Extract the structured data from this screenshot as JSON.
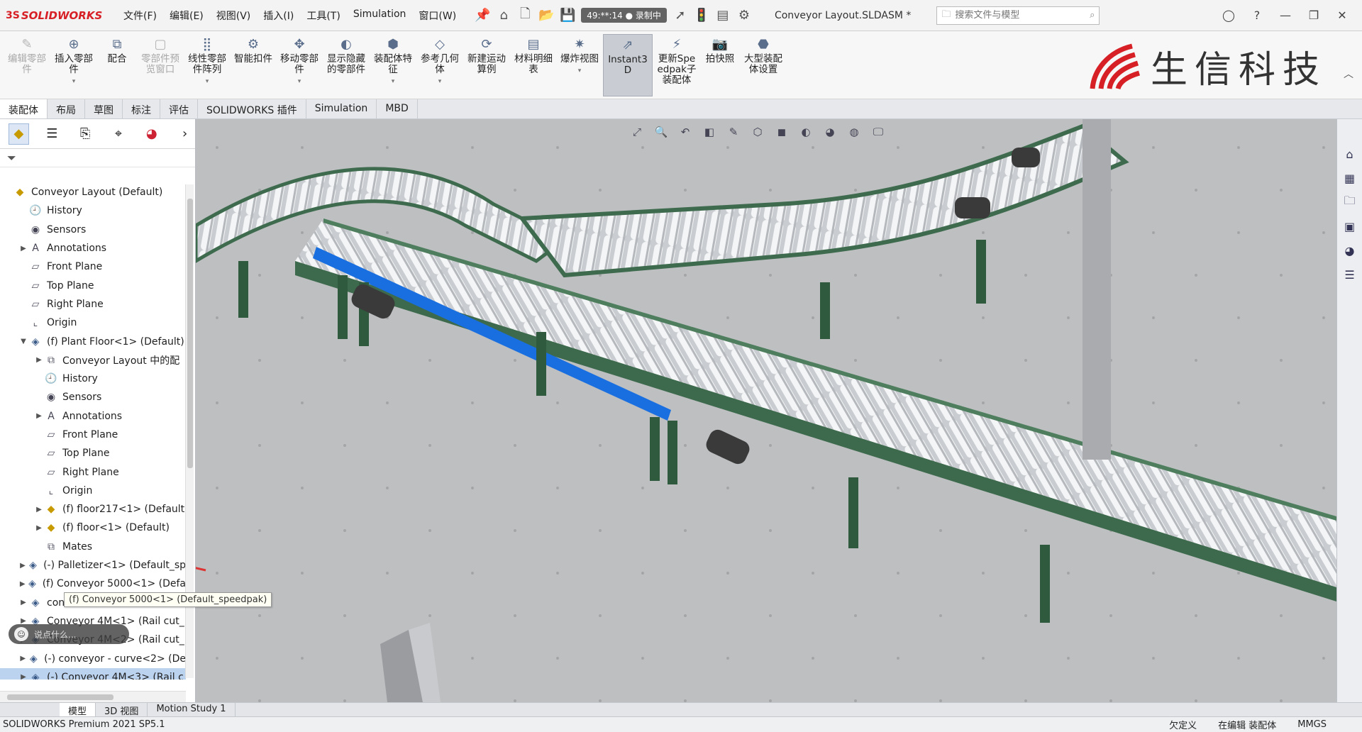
{
  "app": {
    "logo_text": "SOLIDWORKS",
    "logo_ds": "3S",
    "document_title": "Conveyor Layout.SLDASM *",
    "recording_label": "录制中",
    "recording_time": "49:**:14"
  },
  "menu": [
    "文件(F)",
    "编辑(E)",
    "视图(V)",
    "插入(I)",
    "工具(T)",
    "Simulation",
    "窗口(W)"
  ],
  "search": {
    "placeholder": "搜索文件与模型"
  },
  "ribbon": [
    {
      "label": "编辑零部件",
      "disabled": true,
      "icon": "edit-component-icon"
    },
    {
      "label": "插入零部件",
      "disabled": false,
      "icon": "insert-component-icon",
      "caret": true
    },
    {
      "label": "配合",
      "disabled": false,
      "icon": "mate-icon"
    },
    {
      "label": "零部件预览窗口",
      "disabled": true,
      "icon": "component-preview-icon"
    },
    {
      "label": "线性零部件阵列",
      "disabled": false,
      "icon": "linear-pattern-icon",
      "caret": true
    },
    {
      "label": "智能扣件",
      "disabled": false,
      "icon": "smart-fastener-icon"
    },
    {
      "label": "移动零部件",
      "disabled": false,
      "icon": "move-component-icon",
      "caret": true
    },
    {
      "label": "显示隐藏的零部件",
      "disabled": false,
      "icon": "show-hidden-icon"
    },
    {
      "label": "装配体特征",
      "disabled": false,
      "icon": "assembly-feature-icon",
      "caret": true
    },
    {
      "label": "参考几何体",
      "disabled": false,
      "icon": "reference-geometry-icon",
      "caret": true
    },
    {
      "label": "新建运动算例",
      "disabled": false,
      "icon": "motion-study-icon"
    },
    {
      "label": "材料明细表",
      "disabled": false,
      "icon": "bom-icon"
    },
    {
      "label": "爆炸视图",
      "disabled": false,
      "icon": "explode-view-icon",
      "caret": true
    },
    {
      "label": "Instant3D",
      "disabled": false,
      "active": true,
      "icon": "instant3d-icon"
    },
    {
      "label": "更新Speedpak子装配体",
      "disabled": false,
      "icon": "speedpak-icon"
    },
    {
      "label": "拍快照",
      "disabled": false,
      "icon": "snapshot-icon"
    },
    {
      "label": "大型装配体设置",
      "disabled": false,
      "icon": "large-assembly-icon"
    }
  ],
  "brand": {
    "name": "生信科技"
  },
  "command_tabs": [
    {
      "label": "装配体",
      "active": true
    },
    {
      "label": "布局"
    },
    {
      "label": "草图"
    },
    {
      "label": "标注"
    },
    {
      "label": "评估"
    },
    {
      "label": "SOLIDWORKS 插件"
    },
    {
      "label": "Simulation"
    },
    {
      "label": "MBD"
    }
  ],
  "tree": [
    {
      "label": "Conveyor Layout  (Default)",
      "indent": 0,
      "icon": "assembly-icon",
      "arrow": ""
    },
    {
      "label": "History",
      "indent": 1,
      "icon": "history-icon",
      "arrow": ""
    },
    {
      "label": "Sensors",
      "indent": 1,
      "icon": "sensor-icon",
      "arrow": ""
    },
    {
      "label": "Annotations",
      "indent": 1,
      "icon": "annotation-icon",
      "arrow": "▶"
    },
    {
      "label": "Front Plane",
      "indent": 1,
      "icon": "plane-icon",
      "arrow": ""
    },
    {
      "label": "Top Plane",
      "indent": 1,
      "icon": "plane-icon",
      "arrow": ""
    },
    {
      "label": "Right Plane",
      "indent": 1,
      "icon": "plane-icon",
      "arrow": ""
    },
    {
      "label": "Origin",
      "indent": 1,
      "icon": "origin-icon",
      "arrow": ""
    },
    {
      "label": "(f) Plant Floor<1> (Default)",
      "indent": 1,
      "icon": "subassembly-icon",
      "arrow": "▼"
    },
    {
      "label": "Conveyor Layout 中的配",
      "indent": 2,
      "icon": "mate-group-icon",
      "arrow": "▶"
    },
    {
      "label": "History",
      "indent": 2,
      "icon": "history-icon",
      "arrow": ""
    },
    {
      "label": "Sensors",
      "indent": 2,
      "icon": "sensor-icon",
      "arrow": ""
    },
    {
      "label": "Annotations",
      "indent": 2,
      "icon": "annotation-icon",
      "arrow": "▶"
    },
    {
      "label": "Front Plane",
      "indent": 2,
      "icon": "plane-icon",
      "arrow": ""
    },
    {
      "label": "Top Plane",
      "indent": 2,
      "icon": "plane-icon",
      "arrow": ""
    },
    {
      "label": "Right Plane",
      "indent": 2,
      "icon": "plane-icon",
      "arrow": ""
    },
    {
      "label": "Origin",
      "indent": 2,
      "icon": "origin-icon",
      "arrow": ""
    },
    {
      "label": "(f) floor217<1> (Default",
      "indent": 2,
      "icon": "part-icon",
      "arrow": "▶"
    },
    {
      "label": "(f) floor<1> (Default)",
      "indent": 2,
      "icon": "part-icon",
      "arrow": "▶"
    },
    {
      "label": "Mates",
      "indent": 2,
      "icon": "mates-icon",
      "arrow": ""
    },
    {
      "label": "(-) Palletizer<1> (Default_sp",
      "indent": 1,
      "icon": "subassembly-icon",
      "arrow": "▶"
    },
    {
      "label": "(f) Conveyor 5000<1> (Defa",
      "indent": 1,
      "icon": "subassembly-icon",
      "arrow": "▶"
    },
    {
      "label": "con",
      "indent": 1,
      "icon": "subassembly-icon",
      "arrow": "▶"
    },
    {
      "label": "Conveyor 4M<1> (Rail cut_",
      "indent": 1,
      "icon": "subassembly-icon",
      "arrow": "▶"
    },
    {
      "label": "Conveyor 4M<2> (Rail cut_",
      "indent": 1,
      "icon": "subassembly-icon",
      "arrow": "▶"
    },
    {
      "label": "(-) conveyor - curve<2> (De",
      "indent": 1,
      "icon": "subassembly-icon",
      "arrow": "▶"
    },
    {
      "label": "(-) Conveyor 4M<3> (Rail c",
      "indent": 1,
      "icon": "subassembly-icon",
      "arrow": "▶",
      "selected": true
    }
  ],
  "tooltip": "(f) Conveyor 5000<1> (Default_speedpak)",
  "chat_pill": "说点什么...",
  "bottom_tabs": [
    {
      "label": "模型",
      "active": true
    },
    {
      "label": "3D 视图"
    },
    {
      "label": "Motion Study 1"
    }
  ],
  "status": {
    "product": "SOLIDWORKS Premium 2021 SP5.1",
    "constraint": "欠定义",
    "mode": "在编辑 装配体",
    "units": "MMGS"
  }
}
